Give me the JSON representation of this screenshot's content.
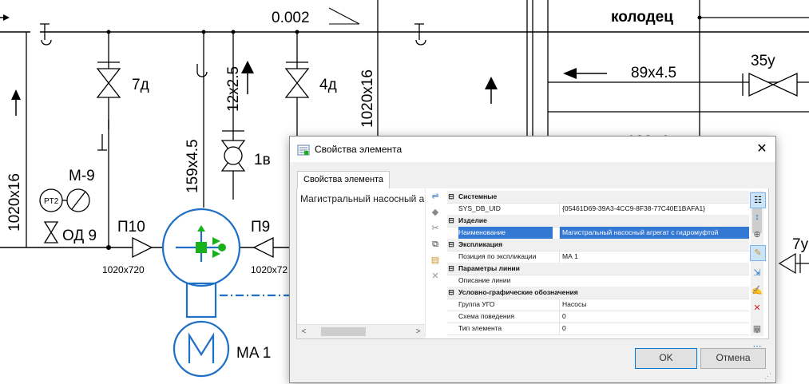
{
  "scheme": {
    "slope_label": "0.002",
    "well_label": "колодец",
    "pipe_labels": [
      "1020x16",
      "159x4.5",
      "12x2.5",
      "1020x16",
      "89x4.5"
    ],
    "valve_labels": [
      "7д",
      "4д",
      "1в",
      "35у",
      "7у"
    ],
    "gauge_label": "M-9",
    "gauge_text": "PT2",
    "od_label": "ОД 9",
    "p10_label": "П10",
    "p9_label": "П9",
    "size_left": "1020x720",
    "size_right": "1020x72",
    "motor_label": "MA 1",
    "pipe_partial": "102x4"
  },
  "dialog": {
    "title": "Свойства элемента",
    "tab_label": "Свойства элемента",
    "list_items": [
      "Магистральный насосный агрегат"
    ],
    "sections": [
      {
        "name": "Системные",
        "rows": [
          {
            "name": "SYS_DB_UID",
            "value": "{05461D69-39A3-4CC9-8F38-77C40E1BAFA1}"
          }
        ]
      },
      {
        "name": "Изделие",
        "rows": [
          {
            "name": "Наименование",
            "value": "Магистральный насосный агрегат с гидромуфтой",
            "selected": true
          }
        ]
      },
      {
        "name": "Экспликация",
        "rows": [
          {
            "name": "Позиция по экспликации",
            "value": "МА 1"
          }
        ]
      },
      {
        "name": "Параметры линии",
        "rows": [
          {
            "name": "Описание линии",
            "value": ""
          }
        ]
      },
      {
        "name": "Условно-графические обозначения",
        "rows": [
          {
            "name": "Группа УГО",
            "value": "Насосы"
          },
          {
            "name": "Схема поведения",
            "value": "0"
          },
          {
            "name": "Тип элемента",
            "value": "0"
          }
        ]
      }
    ],
    "ok_label": "OK",
    "cancel_label": "Отмена"
  },
  "colors": {
    "pump_blue": "#1e6fc5",
    "pump_green": "#19b119",
    "selection_blue": "#3378d3"
  },
  "icons": {
    "title": "properties-icon",
    "close": "close-icon"
  }
}
